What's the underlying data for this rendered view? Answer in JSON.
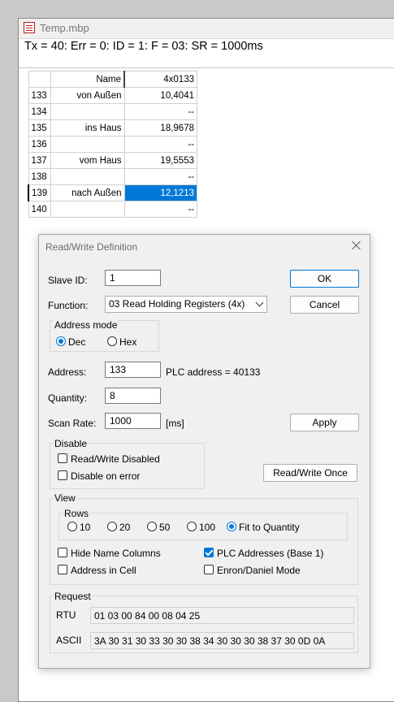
{
  "window": {
    "title": "Temp.mbp",
    "status": "Tx = 40: Err = 0: ID = 1: F = 03: SR = 1000ms"
  },
  "grid": {
    "headers": {
      "name": "Name",
      "value": "4x0133"
    },
    "rows": [
      {
        "num": "133",
        "name": "von Außen",
        "value": "10,4041"
      },
      {
        "num": "134",
        "name": "",
        "value": "--"
      },
      {
        "num": "135",
        "name": "ins Haus",
        "value": "18,9678"
      },
      {
        "num": "136",
        "name": "",
        "value": "--"
      },
      {
        "num": "137",
        "name": "vom Haus",
        "value": "19,5553"
      },
      {
        "num": "138",
        "name": "",
        "value": "--"
      },
      {
        "num": "139",
        "name": "nach Außen",
        "value": "12,1213"
      },
      {
        "num": "140",
        "name": "",
        "value": "--"
      }
    ]
  },
  "dialog": {
    "title": "Read/Write Definition",
    "slave_id": {
      "label": "Slave ID:",
      "value": "1"
    },
    "function": {
      "label": "Function:",
      "value": "03 Read Holding Registers (4x)"
    },
    "address_mode": {
      "title": "Address mode",
      "dec": "Dec",
      "hex": "Hex",
      "selected": "Dec"
    },
    "address": {
      "label": "Address:",
      "value": "133",
      "plc": "PLC address = 40133"
    },
    "quantity": {
      "label": "Quantity:",
      "value": "8"
    },
    "scan_rate": {
      "label": "Scan Rate:",
      "value": "1000",
      "unit": "[ms]"
    },
    "buttons": {
      "ok": "OK",
      "cancel": "Cancel",
      "apply": "Apply",
      "rw_once": "Read/Write Once"
    },
    "disable": {
      "title": "Disable",
      "rw_disabled": "Read/Write Disabled",
      "on_error": "Disable on error"
    },
    "view": {
      "title": "View",
      "rows_title": "Rows",
      "rows_options": [
        "10",
        "20",
        "50",
        "100",
        "Fit to Quantity"
      ],
      "rows_selected": "Fit to Quantity",
      "hide_names": "Hide Name Columns",
      "plc_addresses": "PLC Addresses (Base 1)",
      "address_in_cell": "Address in Cell",
      "enron": "Enron/Daniel Mode"
    },
    "request": {
      "title": "Request",
      "rtu_label": "RTU",
      "rtu": "01 03 00 84 00 08 04 25",
      "ascii_label": "ASCII",
      "ascii": "3A 30 31 30 33 30 30 38 34 30 30 30 38 37 30 0D 0A"
    }
  }
}
